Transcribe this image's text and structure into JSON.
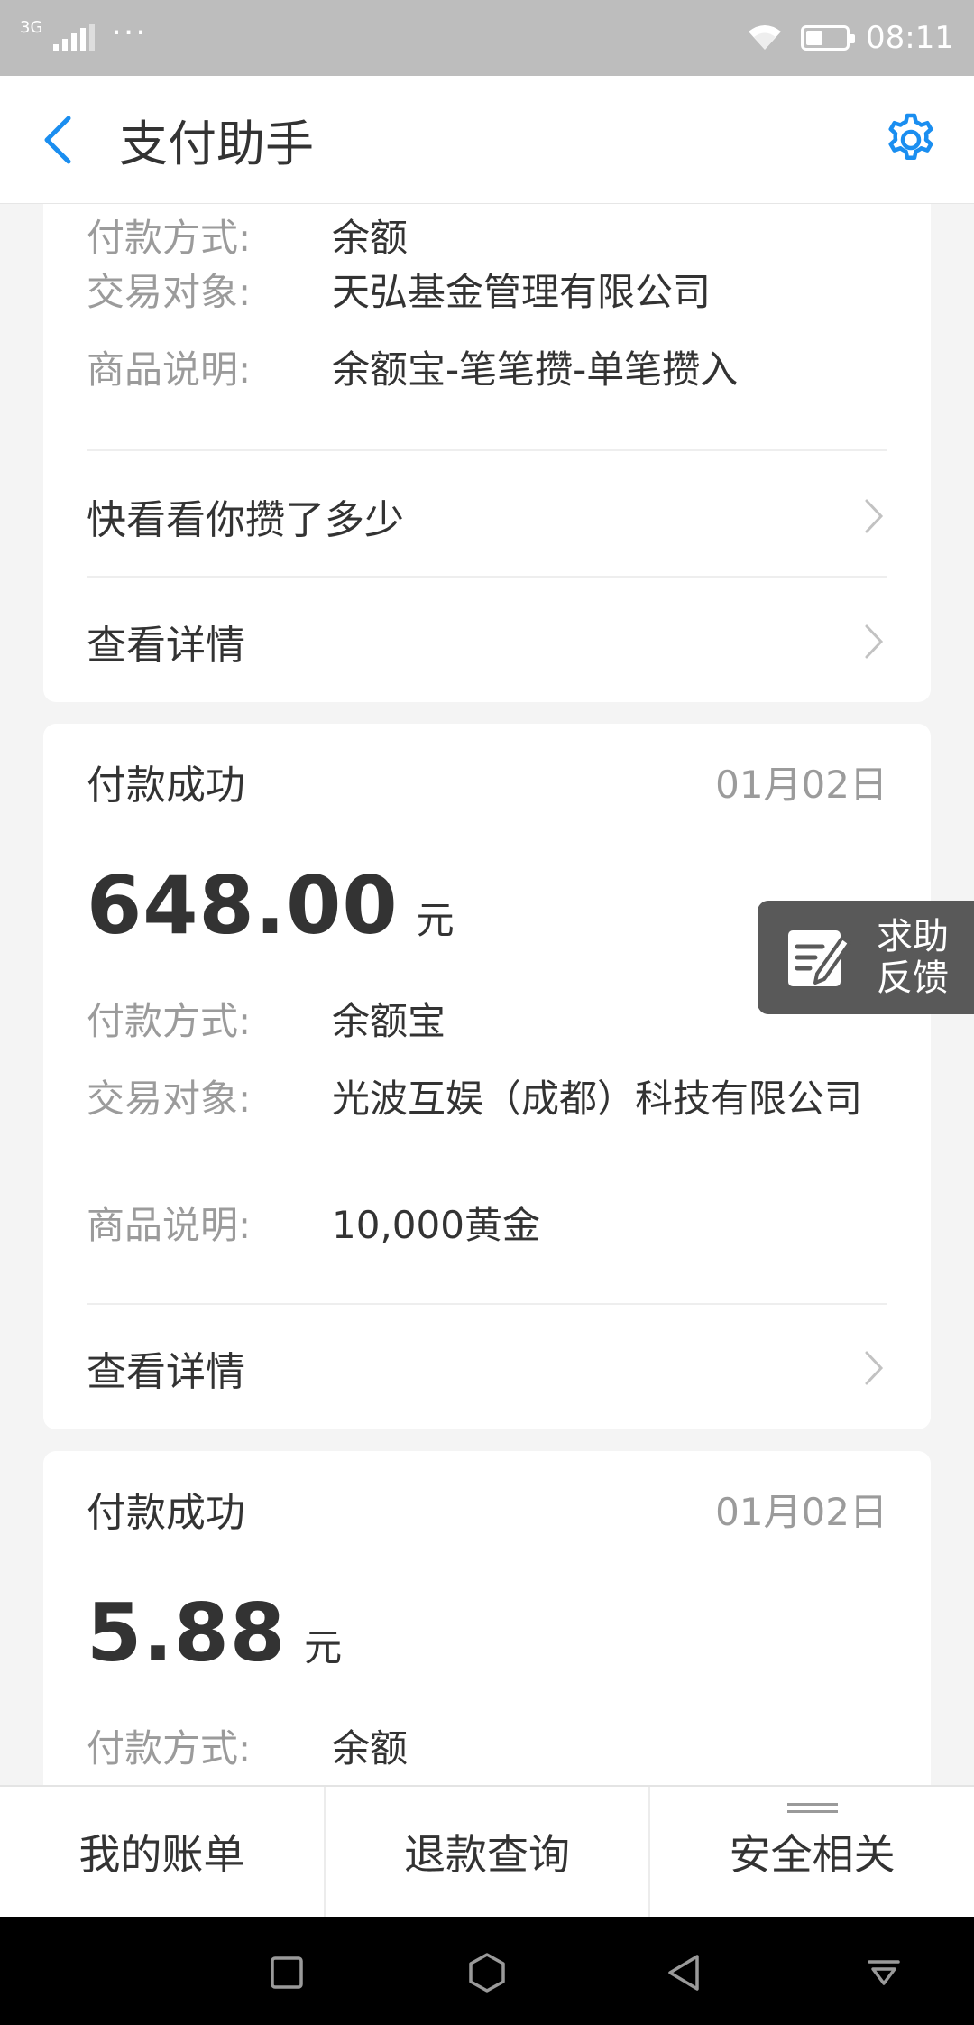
{
  "status_bar": {
    "network": "3G",
    "more": "···",
    "time": "08:11"
  },
  "header": {
    "title": "支付助手"
  },
  "card_top": {
    "rows": [
      {
        "label": "付款方式:",
        "value": "余额"
      },
      {
        "label": "交易对象:",
        "value": "天弘基金管理有限公司"
      },
      {
        "label": "商品说明:",
        "value": "余额宝-笔笔攒-单笔攒入"
      }
    ],
    "links": [
      "快看看你攒了多少",
      "查看详情"
    ]
  },
  "card_mid": {
    "status": "付款成功",
    "date": "01月02日",
    "amount": "648.00",
    "unit": "元",
    "rows": [
      {
        "label": "付款方式:",
        "value": "余额宝"
      },
      {
        "label": "交易对象:",
        "value": "光波互娱（成都）科技有限公司"
      },
      {
        "label": "商品说明:",
        "value": "10,000黄金"
      }
    ],
    "link": "查看详情"
  },
  "card_bottom": {
    "status": "付款成功",
    "date": "01月02日",
    "amount": "5.88",
    "unit": "元",
    "rows": [
      {
        "label": "付款方式:",
        "value": "余额"
      }
    ]
  },
  "feedback": {
    "line1": "求助",
    "line2": "反馈"
  },
  "tabs": [
    "我的账单",
    "退款查询",
    "安全相关"
  ],
  "colors": {
    "accent": "#1a8ef0",
    "text": "#333333",
    "muted": "#9b9b9b",
    "background": "#f4f4f4"
  }
}
